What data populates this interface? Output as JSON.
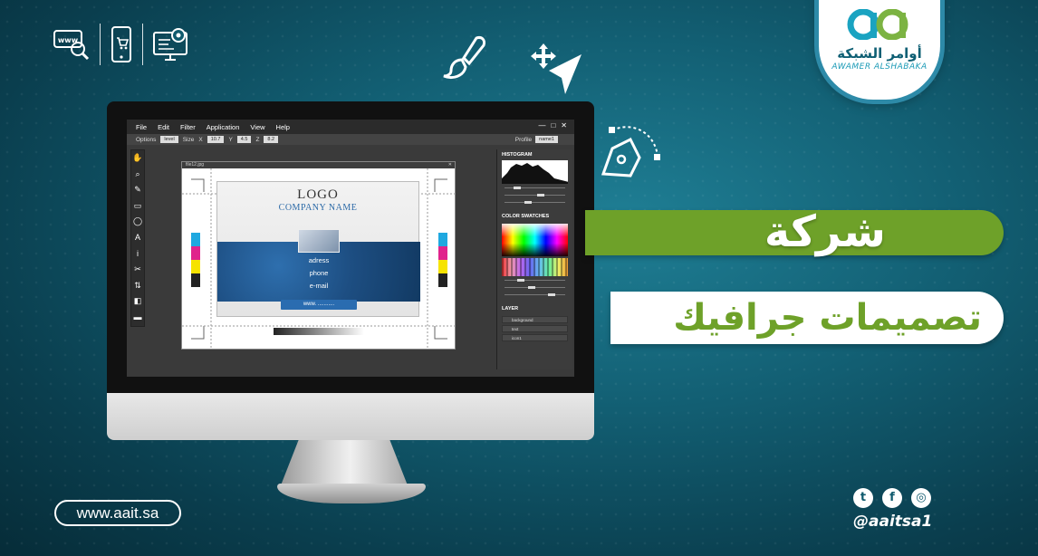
{
  "brand": {
    "name_ar": "أوامر الشبكة",
    "name_en": "AWAMER ALSHABAKA",
    "primary_color": "#0e5f74",
    "accent_color": "#6ea129"
  },
  "top_icons": [
    "www-search-icon",
    "mobile-cart-icon",
    "monitor-settings-icon"
  ],
  "floating_icons": [
    "paintbrush-icon",
    "move-arrows-icon",
    "cursor-arrow-icon",
    "pen-tool-icon"
  ],
  "editor": {
    "menu": [
      "File",
      "Edit",
      "Filter",
      "Application",
      "View",
      "Help"
    ],
    "window_controls": [
      "—",
      "□",
      "✕"
    ],
    "options": {
      "options_label": "Options",
      "options_value": "level",
      "size_label": "Size",
      "x_label": "X",
      "x_value": "10.7",
      "y_label": "Y",
      "y_value": "4.5",
      "z_label": "Z",
      "z_value": "8.2",
      "profile_label": "Profile",
      "profile_value": "name1"
    },
    "tools": [
      "✋",
      "⌕",
      "✎",
      "▭",
      "◯",
      "A",
      "i",
      "✂",
      "⇅",
      "◧",
      "▬"
    ],
    "file_name": "file12.jpg",
    "card": {
      "logo": "LOGO",
      "company": "COMPANY NAME",
      "lines": [
        "adress",
        "phone",
        "e-mail"
      ],
      "web": "www. ..........."
    },
    "panels": {
      "histogram": "HISTOGRAM",
      "swatches": "COLOR SWATCHES",
      "layer": "LAYER",
      "layers": [
        "background",
        "text",
        "icon1"
      ]
    }
  },
  "headline": {
    "line1": "شركة",
    "line2": "تصميمات جرافيك"
  },
  "website": "www.aait.sa",
  "social": {
    "icons": [
      "twitter-icon",
      "facebook-icon",
      "instagram-icon"
    ],
    "glyphs": [
      "t",
      "f",
      "◎"
    ],
    "handle": "@aaitsa1"
  }
}
